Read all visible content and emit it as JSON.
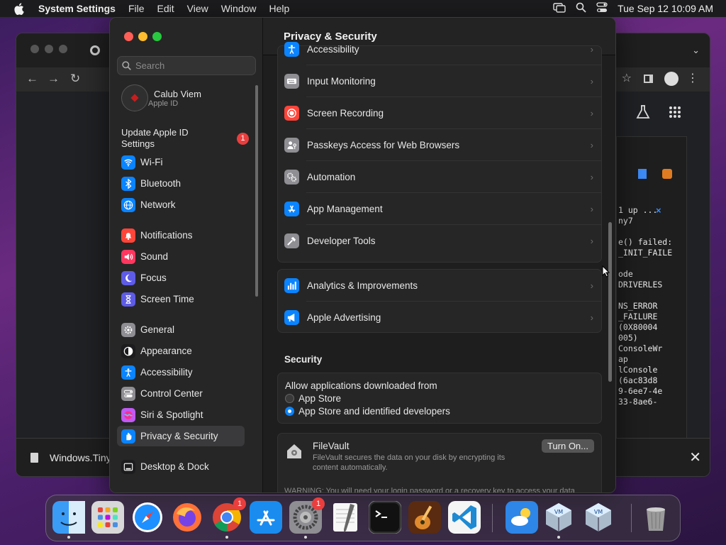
{
  "menubar": {
    "app_name": "System Settings",
    "menus": [
      "File",
      "Edit",
      "View",
      "Window",
      "Help"
    ],
    "clock": "Tue Sep 12  10:09 AM"
  },
  "background_window": {
    "download_name": "Windows.Tiny",
    "log_lines": [
      "1 up ...",
      "ny7",
      "",
      "e() failed:",
      "_INIT_FAILE",
      "",
      "ode",
      "DRIVERLES",
      "",
      "NS_ERROR",
      "_FAILURE",
      "(0X80004",
      "005)",
      "ConsoleWr",
      "ap",
      "lConsole",
      "(6ac83d8",
      "9-6ee7-4e",
      "33-8ae6-"
    ]
  },
  "sidebar": {
    "search_placeholder": "Search",
    "account": {
      "name": "Calub Viem",
      "subtitle": "Apple ID"
    },
    "update": {
      "label": "Update Apple ID Settings",
      "badge": "1"
    },
    "items": [
      {
        "label": "Wi-Fi",
        "color": "#0a84ff",
        "icon": "wifi-icon"
      },
      {
        "label": "Bluetooth",
        "color": "#0a84ff",
        "icon": "bluetooth-icon"
      },
      {
        "label": "Network",
        "color": "#0a84ff",
        "icon": "globe-icon"
      },
      {
        "label": "Notifications",
        "color": "#ff453a",
        "icon": "bell-icon"
      },
      {
        "label": "Sound",
        "color": "#ff375f",
        "icon": "speaker-icon"
      },
      {
        "label": "Focus",
        "color": "#5e5ce6",
        "icon": "moon-icon"
      },
      {
        "label": "Screen Time",
        "color": "#5e5ce6",
        "icon": "hourglass-icon"
      },
      {
        "label": "General",
        "color": "#8e8e93",
        "icon": "gear-icon"
      },
      {
        "label": "Appearance",
        "color": "#1c1c1e",
        "icon": "appearance-icon"
      },
      {
        "label": "Accessibility",
        "color": "#0a84ff",
        "icon": "accessibility-icon"
      },
      {
        "label": "Control Center",
        "color": "#8e8e93",
        "icon": "toggles-icon"
      },
      {
        "label": "Siri & Spotlight",
        "color": "#bf5af2",
        "icon": "siri-icon"
      },
      {
        "label": "Privacy & Security",
        "color": "#0a84ff",
        "icon": "hand-icon"
      },
      {
        "label": "Desktop & Dock",
        "color": "#1c1c1e",
        "icon": "dock-icon"
      }
    ],
    "selected_index": 12
  },
  "content": {
    "title": "Privacy & Security",
    "privacy_rows": [
      {
        "label": "Accessibility",
        "color": "#0a84ff",
        "icon": "accessibility-icon"
      },
      {
        "label": "Input Monitoring",
        "color": "#8e8e93",
        "icon": "keyboard-icon"
      },
      {
        "label": "Screen Recording",
        "color": "#ff453a",
        "icon": "record-icon"
      },
      {
        "label": "Passkeys Access for Web Browsers",
        "color": "#8e8e93",
        "icon": "person-key-icon"
      },
      {
        "label": "Automation",
        "color": "#8e8e93",
        "icon": "gears-icon"
      },
      {
        "label": "App Management",
        "color": "#0a84ff",
        "icon": "app-store-icon"
      },
      {
        "label": "Developer Tools",
        "color": "#8e8e93",
        "icon": "hammer-icon"
      }
    ],
    "analytics_rows": [
      {
        "label": "Analytics & Improvements",
        "color": "#0a84ff",
        "icon": "bar-chart-icon"
      },
      {
        "label": "Apple Advertising",
        "color": "#0a84ff",
        "icon": "megaphone-icon"
      }
    ],
    "security": {
      "heading": "Security",
      "allow_label": "Allow applications downloaded from",
      "options": [
        "App Store",
        "App Store and identified developers"
      ],
      "selected": 1
    },
    "filevault": {
      "title": "FileVault",
      "description": "FileVault secures the data on your disk by encrypting its content automatically.",
      "button": "Turn On...",
      "warning": "WARNING: You will need your login password or a recovery key to access your data"
    }
  },
  "dock": {
    "items": [
      {
        "name": "finder-icon",
        "running": true
      },
      {
        "name": "launchpad-icon",
        "running": false
      },
      {
        "name": "safari-icon",
        "running": false
      },
      {
        "name": "firefox-icon",
        "running": false
      },
      {
        "name": "chrome-icon",
        "running": true,
        "badge": "1"
      },
      {
        "name": "app-store-icon",
        "running": false
      },
      {
        "name": "system-settings-icon",
        "running": true,
        "badge": "1"
      },
      {
        "name": "textedit-icon",
        "running": false
      },
      {
        "name": "terminal-icon",
        "running": false
      },
      {
        "name": "garageband-icon",
        "running": false
      },
      {
        "name": "vscode-icon",
        "running": false
      },
      {
        "name": "weather-icon",
        "running": false
      },
      {
        "name": "virtualbox-icon",
        "running": true
      },
      {
        "name": "virtualbox-vm-icon",
        "running": false
      },
      {
        "name": "trash-icon",
        "running": false
      }
    ]
  }
}
